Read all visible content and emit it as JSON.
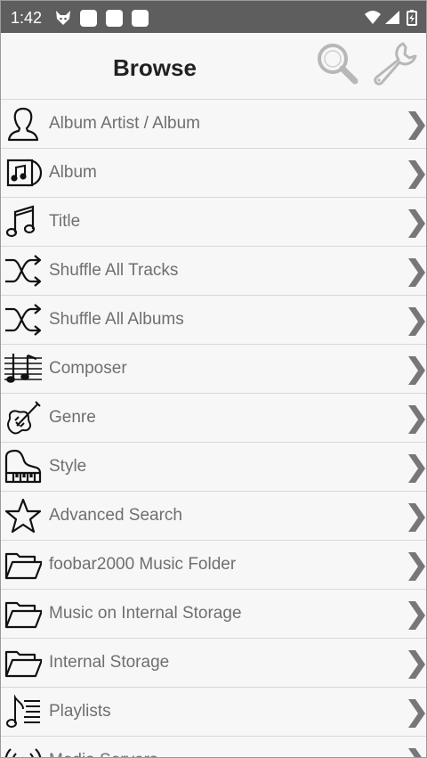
{
  "status_bar": {
    "time": "1:42",
    "background": "#5e5e5e"
  },
  "header": {
    "title": "Browse",
    "search_icon": "search-icon",
    "settings_icon": "wrench-icon"
  },
  "list": {
    "items": [
      {
        "label": "Album Artist / Album",
        "icon": "person-icon"
      },
      {
        "label": "Album",
        "icon": "album-icon"
      },
      {
        "label": "Title",
        "icon": "music-note-icon"
      },
      {
        "label": "Shuffle All Tracks",
        "icon": "shuffle-icon"
      },
      {
        "label": "Shuffle All Albums",
        "icon": "shuffle-icon"
      },
      {
        "label": "Composer",
        "icon": "sheet-music-icon"
      },
      {
        "label": "Genre",
        "icon": "violin-icon"
      },
      {
        "label": "Style",
        "icon": "piano-icon"
      },
      {
        "label": "Advanced Search",
        "icon": "star-icon"
      },
      {
        "label": "foobar2000 Music Folder",
        "icon": "folder-icon"
      },
      {
        "label": "Music on Internal Storage",
        "icon": "folder-icon"
      },
      {
        "label": "Internal Storage",
        "icon": "folder-icon"
      },
      {
        "label": "Playlists",
        "icon": "playlist-icon"
      },
      {
        "label": "Media Servers",
        "icon": "broadcast-icon"
      }
    ]
  }
}
